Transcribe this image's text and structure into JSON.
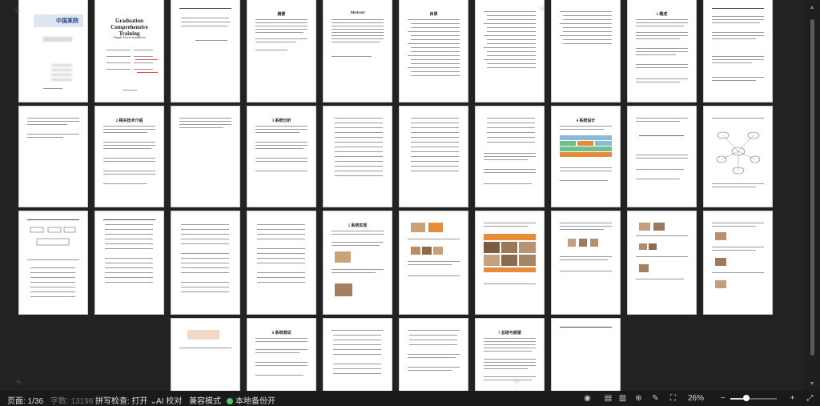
{
  "document": {
    "cover_title": "Graduation Comprehensive Training",
    "cover_subtitle": "Simple Novel translation",
    "cover_logo_text": "中国某院",
    "page_headings": [
      "摘要",
      "Abstract",
      "目录",
      "1 概述",
      "2 相关技术介绍",
      "3 系统分析",
      "4 系统设计",
      "5 系统实现",
      "6 系统测试",
      "7 总结与展望"
    ]
  },
  "status_bar": {
    "page_indicator": "页面: 1/36",
    "word_count": "字数: 13198",
    "spell_check": "拼写检查: 打开",
    "spell_check_chevron": "⌄",
    "ai_check": "AI 校对",
    "compat_mode": "兼容模式",
    "backup": "本地备份开",
    "zoom_level": "26%",
    "zoom_fraction": 0.35,
    "colors": {
      "backup_dot": "#4cc76b"
    }
  },
  "icons": {
    "view_eye": "eye-icon",
    "single_page": "page-view-icon",
    "book_view": "book-view-icon",
    "web_view": "globe-icon",
    "edit": "pen-icon",
    "fit": "fit-screen-icon",
    "zoom_out": "minus-icon",
    "zoom_in": "plus-icon",
    "expand": "expand-icon"
  }
}
